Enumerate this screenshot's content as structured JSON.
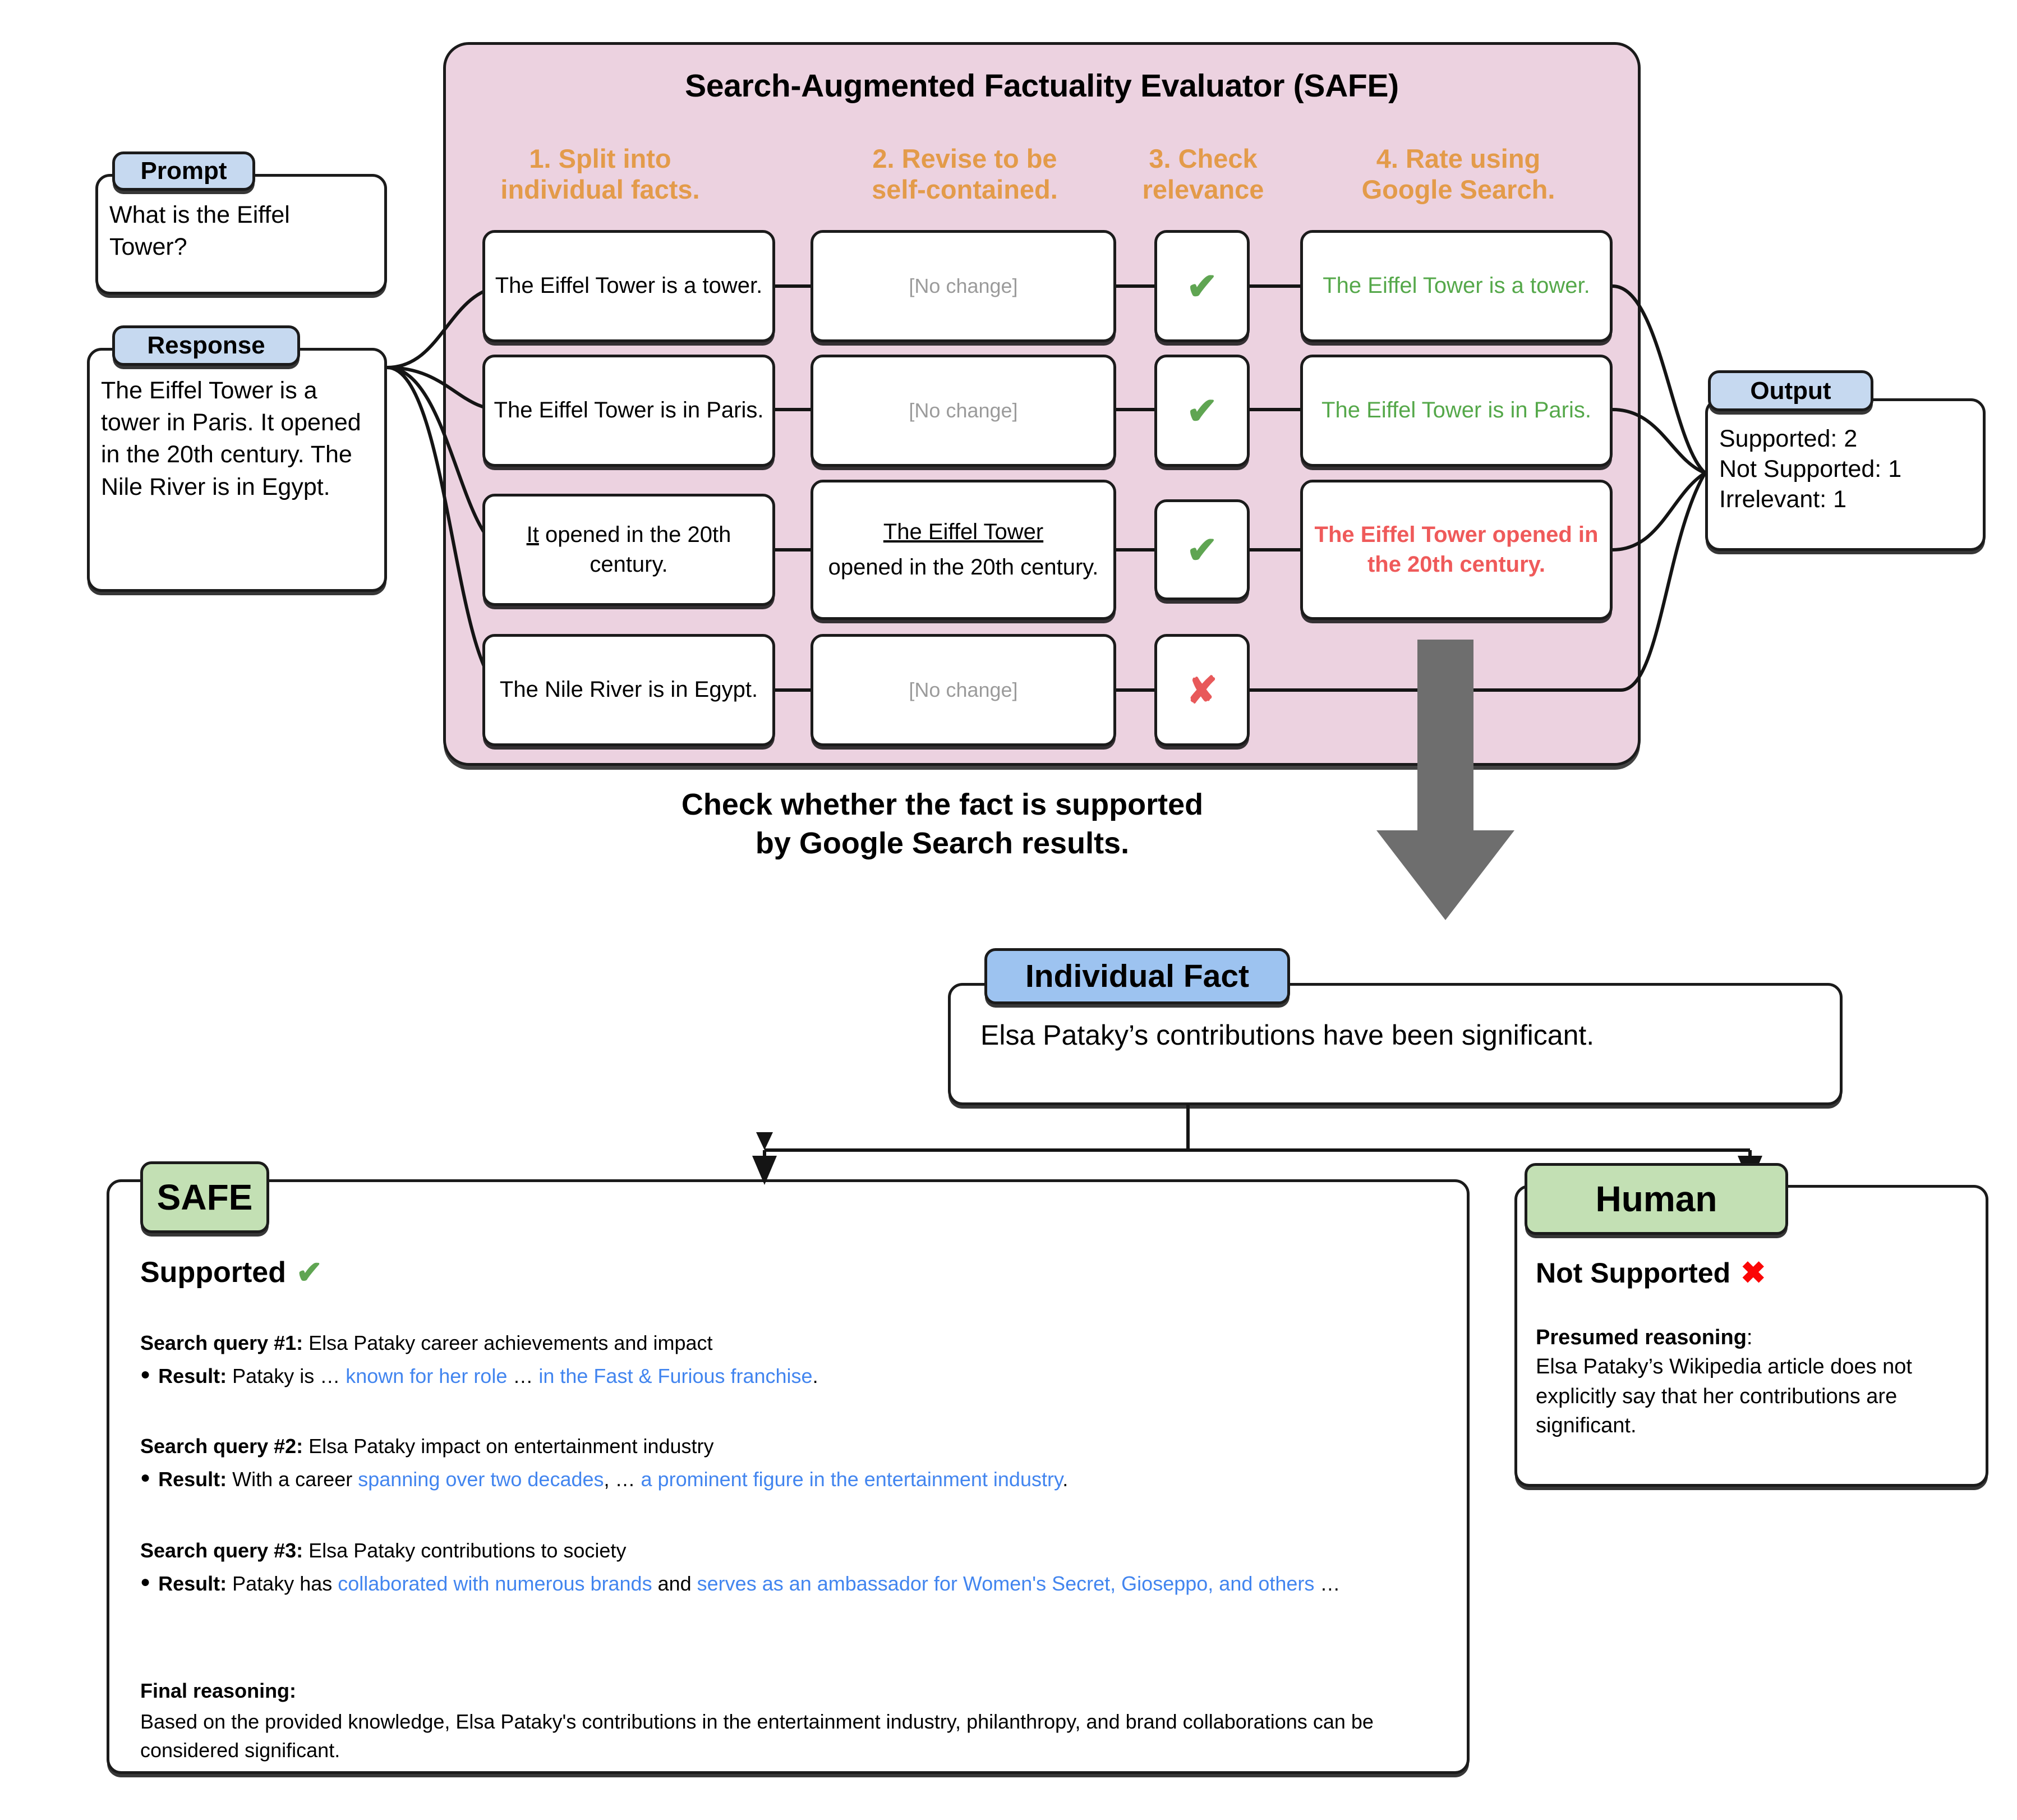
{
  "pipeline": {
    "title": "Search-Augmented Factuality Evaluator (SAFE)",
    "columns": [
      {
        "line1": "1. Split into",
        "line2": "individual facts."
      },
      {
        "line1": "2. Revise to be",
        "line2": "self-contained."
      },
      {
        "line1": "3. Check",
        "line2": "relevance"
      },
      {
        "line1": "4. Rate using",
        "line2": "Google Search."
      }
    ],
    "rows": [
      {
        "fact": "The Eiffel Tower is a tower.",
        "revised": "[No change]",
        "relevance": "✔",
        "rated": "The Eiffel Tower is a tower.",
        "rated_state": "supported"
      },
      {
        "fact": "The Eiffel Tower is in Paris.",
        "revised": "[No change]",
        "relevance": "✔",
        "rated": "The Eiffel Tower is in Paris.",
        "rated_state": "supported"
      },
      {
        "fact_underlined": "It",
        "fact_rest": " opened in the 20th century.",
        "revised_underlined": "The Eiffel Tower",
        "revised_rest": "opened in the 20th century.",
        "relevance": "✔",
        "rated": "The Eiffel Tower opened in the 20th century.",
        "rated_state": "not-supported"
      },
      {
        "fact": "The Nile River is in Egypt.",
        "revised": "[No change]",
        "relevance": "✘",
        "rated": "",
        "rated_state": "irrelevant"
      }
    ]
  },
  "prompt": {
    "tag": "Prompt",
    "text": "What is the Eiffel Tower?"
  },
  "response": {
    "tag": "Response",
    "text": "The Eiffel Tower is a tower in Paris. It opened in the 20th century. The Nile River is in Egypt."
  },
  "output": {
    "tag": "Output",
    "lines": [
      "Supported: 2",
      "Not Supported: 1",
      "Irrelevant: 1"
    ]
  },
  "mid_caption": {
    "line1": "Check whether the fact is supported",
    "line2": "by Google Search results."
  },
  "individual_fact": {
    "tag": "Individual Fact",
    "text": "Elsa Pataky’s contributions have been significant."
  },
  "safe_panel": {
    "tag": "SAFE",
    "verdict": "Supported",
    "verdict_mark": "✔",
    "queries": [
      {
        "label": "Search query #1:",
        "query": " Elsa Pataky career achievements and impact",
        "result_label": "Result:",
        "result_parts": [
          {
            "text": " Pataky is … ",
            "style": "plain"
          },
          {
            "text": "known for her role",
            "style": "blue"
          },
          {
            "text": " … ",
            "style": "plain"
          },
          {
            "text": "in the Fast & Furious franchise",
            "style": "blue"
          },
          {
            "text": ".",
            "style": "plain"
          }
        ]
      },
      {
        "label": "Search query #2:",
        "query": " Elsa Pataky impact on entertainment industry",
        "result_label": "Result:",
        "result_parts": [
          {
            "text": " With a career ",
            "style": "plain"
          },
          {
            "text": "spanning over two decades",
            "style": "blue"
          },
          {
            "text": ", … ",
            "style": "plain"
          },
          {
            "text": "a prominent figure in the entertainment industry",
            "style": "blue"
          },
          {
            "text": ".",
            "style": "plain"
          }
        ]
      },
      {
        "label": "Search query #3:",
        "query": " Elsa Pataky contributions to society",
        "result_label": "Result:",
        "result_parts": [
          {
            "text": " Pataky has ",
            "style": "plain"
          },
          {
            "text": "collaborated with numerous brands",
            "style": "blue"
          },
          {
            "text": " and ",
            "style": "plain"
          },
          {
            "text": "serves as an ambassador for Women's Secret, Gioseppo, and others",
            "style": "blue"
          },
          {
            "text": " …",
            "style": "plain"
          }
        ]
      }
    ],
    "final_label": "Final reasoning:",
    "final_text": "Based on the provided knowledge, Elsa Pataky's contributions in the entertainment industry, philanthropy, and brand collaborations can be considered significant."
  },
  "human_panel": {
    "tag": "Human",
    "verdict": "Not Supported",
    "verdict_mark": "✖",
    "reason_label": "Presumed reasoning",
    "reason_colon": ":",
    "reason_text": "Elsa Pataky’s Wikipedia article does not explicitly say that her contributions are significant."
  },
  "colors": {
    "pink_panel": "#ecd2e0",
    "tag_blue": "#c6d9f0",
    "tag_blue_strong": "#9dc3f0",
    "tag_green": "#c3e0b4",
    "orange": "#e39b4a",
    "green_text": "#55a84a",
    "red_text": "#ef5a5a",
    "link_blue": "#4285ef",
    "arrow_grey": "#6e6e6e"
  }
}
